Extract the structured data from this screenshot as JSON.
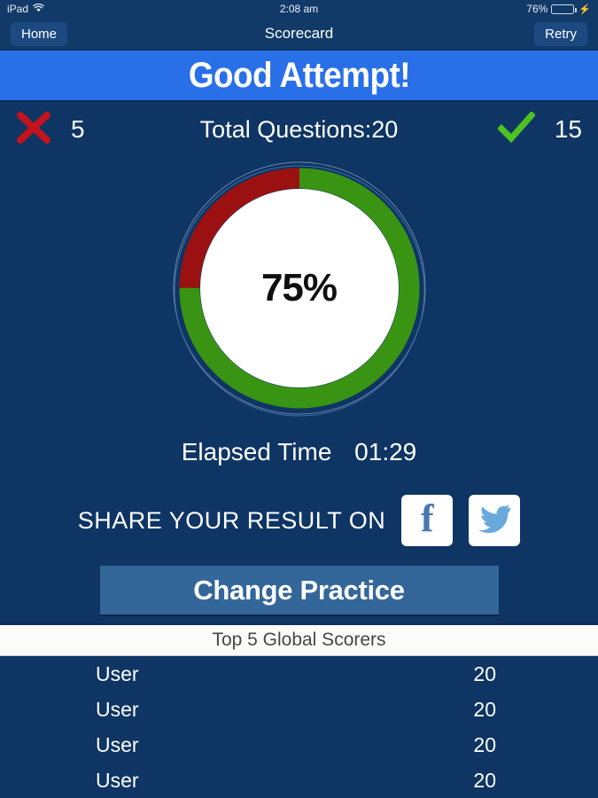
{
  "statusbar": {
    "device": "iPad",
    "wifi_icon": "wifi-icon",
    "time": "2:08 am",
    "battery_percent": "76%",
    "battery_level": 76,
    "charging_icon": "lightning-bolt-icon"
  },
  "navbar": {
    "home_label": "Home",
    "title": "Scorecard",
    "retry_label": "Retry"
  },
  "banner": {
    "headline": "Good Attempt!",
    "color": "#2970e8"
  },
  "stats": {
    "wrong_icon": "cross-icon",
    "wrong_count": "5",
    "wrong_color": "#c3141e",
    "total_label": "Total Questions:20",
    "correct_icon": "check-icon",
    "correct_count": "15",
    "correct_color": "#4cc321"
  },
  "chart_data": {
    "type": "pie",
    "title": "Score percentage donut",
    "center_label": "75%",
    "labels": [
      "Correct",
      "Incorrect"
    ],
    "values": [
      75,
      25
    ],
    "colors": [
      "#3a9413",
      "#9b1111"
    ],
    "start_angle_deg": 0,
    "direction": "clockwise",
    "inner_radius_ratio": 0.84,
    "legend": "none"
  },
  "elapsed": {
    "label": "Elapsed Time",
    "value": "01:29"
  },
  "share": {
    "label": "SHARE YOUR RESULT ON",
    "buttons": [
      {
        "name": "facebook-share-button",
        "icon": "facebook-icon",
        "glyph": "f",
        "color": "#4a77ad"
      },
      {
        "name": "twitter-share-button",
        "icon": "twitter-icon",
        "glyph": "twitter-bird",
        "color": "#6aa9dc"
      }
    ]
  },
  "cta": {
    "label": "Change Practice",
    "color": "#336699"
  },
  "leaderboard": {
    "header": "Top 5 Global Scorers",
    "rows": [
      {
        "name": "User",
        "score": "20"
      },
      {
        "name": "User",
        "score": "20"
      },
      {
        "name": "User",
        "score": "20"
      },
      {
        "name": "User",
        "score": "20"
      }
    ]
  }
}
